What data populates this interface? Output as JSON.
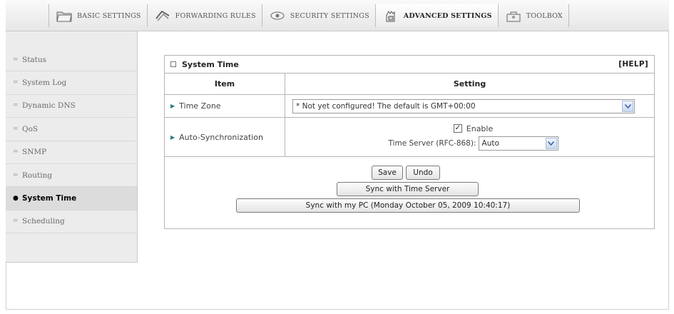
{
  "nav": {
    "tabs": [
      {
        "label": "BASIC SETTINGS",
        "icon": "folder-icon"
      },
      {
        "label": "FORWARDING RULES",
        "icon": "forward-arrows-icon"
      },
      {
        "label": "SECURITY SETTINGS",
        "icon": "eye-lock-icon"
      },
      {
        "label": "ADVANCED SETTINGS",
        "icon": "hand-settings-icon"
      },
      {
        "label": "TOOLBOX",
        "icon": "toolbox-icon"
      }
    ],
    "active": "ADVANCED SETTINGS"
  },
  "sidebar": {
    "items": [
      {
        "label": "Status"
      },
      {
        "label": "System Log"
      },
      {
        "label": "Dynamic DNS"
      },
      {
        "label": "QoS"
      },
      {
        "label": "SNMP"
      },
      {
        "label": "Routing"
      },
      {
        "label": "System Time"
      },
      {
        "label": "Scheduling"
      }
    ],
    "active": "System Time"
  },
  "panel": {
    "title": "System Time",
    "help": "[HELP]",
    "col_item": "Item",
    "col_setting": "Setting",
    "time_zone_label": "Time Zone",
    "time_zone_value": "* Not yet configured! The default is GMT+00:00",
    "auto_sync_label": "Auto-Synchronization",
    "enable_label": "Enable",
    "enable_checked": true,
    "time_server_label": "Time Server (RFC-868):",
    "time_server_value": "Auto",
    "save_label": "Save",
    "undo_label": "Undo",
    "sync_server_label": "Sync with Time Server",
    "sync_pc_label": "Sync with my PC (Monday October 05, 2009 10:40:17)"
  },
  "colors": {
    "arrow": "#2a7a88",
    "sidebar_bg": "#ececec",
    "dropdown_arrow": "#3a63a8"
  }
}
